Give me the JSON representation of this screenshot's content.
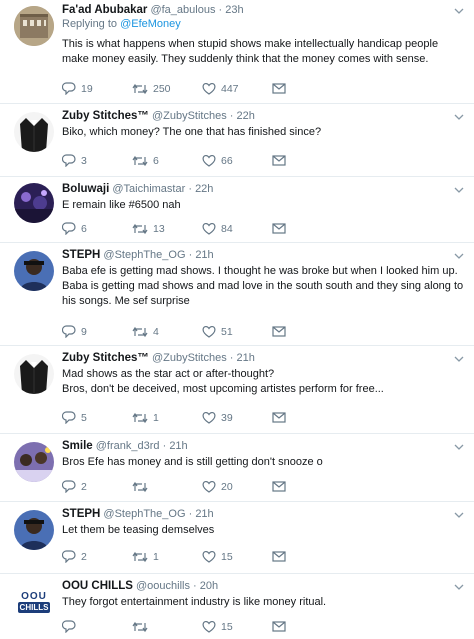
{
  "tweets": [
    {
      "name": "Fa'ad Abubakar",
      "handle": "@fa_abulous",
      "time": "23h",
      "replying_prefix": "Replying to ",
      "replying_to": "@EfeMoney",
      "text": "This is what happens when stupid shows make intellectually handicap people make money easily. They suddenly think that the money comes with sense.",
      "replies": "19",
      "retweets": "250",
      "likes": "447",
      "avatar": "building-photo",
      "avatar_color": "#8c7a62"
    },
    {
      "name": "Zuby Stitches™",
      "handle": "@ZubyStitches",
      "time": "22h",
      "text": "Biko, which money? The one that has finished since?",
      "replies": "3",
      "retweets": "6",
      "likes": "66",
      "avatar": "suit-jacket",
      "avatar_color": "#1a1a1a"
    },
    {
      "name": "Boluwaji",
      "handle": "@Taichimastar",
      "time": "22h",
      "text": "E remain like #6500 nah",
      "replies": "6",
      "retweets": "13",
      "likes": "84",
      "avatar": "night-photo",
      "avatar_color": "#3a2a6e"
    },
    {
      "name": "STEPH",
      "handle": "@StephThe_OG",
      "time": "21h",
      "text": "Baba efe is getting mad shows.  I thought he was broke but when I looked him up.  Baba is getting mad shows and mad love in the south south and they sing along to his songs.  Me sef surprise",
      "replies": "9",
      "retweets": "4",
      "likes": "51",
      "avatar": "person-blue",
      "avatar_color": "#2b4a8a"
    },
    {
      "name": "Zuby Stitches™",
      "handle": "@ZubyStitches",
      "time": "21h",
      "text": "Mad shows as the star act or after-thought?\nBros, don't be deceived, most upcoming artistes perform for free...",
      "replies": "5",
      "retweets": "1",
      "likes": "39",
      "avatar": "suit-jacket",
      "avatar_color": "#1a1a1a"
    },
    {
      "name": "Smile",
      "handle": "@frank_d3rd",
      "time": "21h",
      "text": "Bros Efe has money and is still getting don't snooze o",
      "replies": "2",
      "retweets": "",
      "likes": "20",
      "avatar": "group-photo",
      "avatar_color": "#6a5a9a"
    },
    {
      "name": "STEPH",
      "handle": "@StephThe_OG",
      "time": "21h",
      "text": "Let them be teasing demselves",
      "replies": "2",
      "retweets": "1",
      "likes": "15",
      "avatar": "person-blue",
      "avatar_color": "#2b4a8a"
    },
    {
      "name": "OOU CHILLS",
      "handle": "@oouchills",
      "time": "20h",
      "text": "They forgot entertainment industry is like money ritual.",
      "replies": "",
      "retweets": "",
      "likes": "15",
      "avatar": "oou-chills-logo",
      "avatar_color": "#1c3d7a",
      "logo_top": "OOU",
      "logo_bottom": "CHILLS"
    }
  ],
  "colors": {
    "link": "#1b95e0",
    "muted": "#657786",
    "divider": "#e6ecf0"
  }
}
